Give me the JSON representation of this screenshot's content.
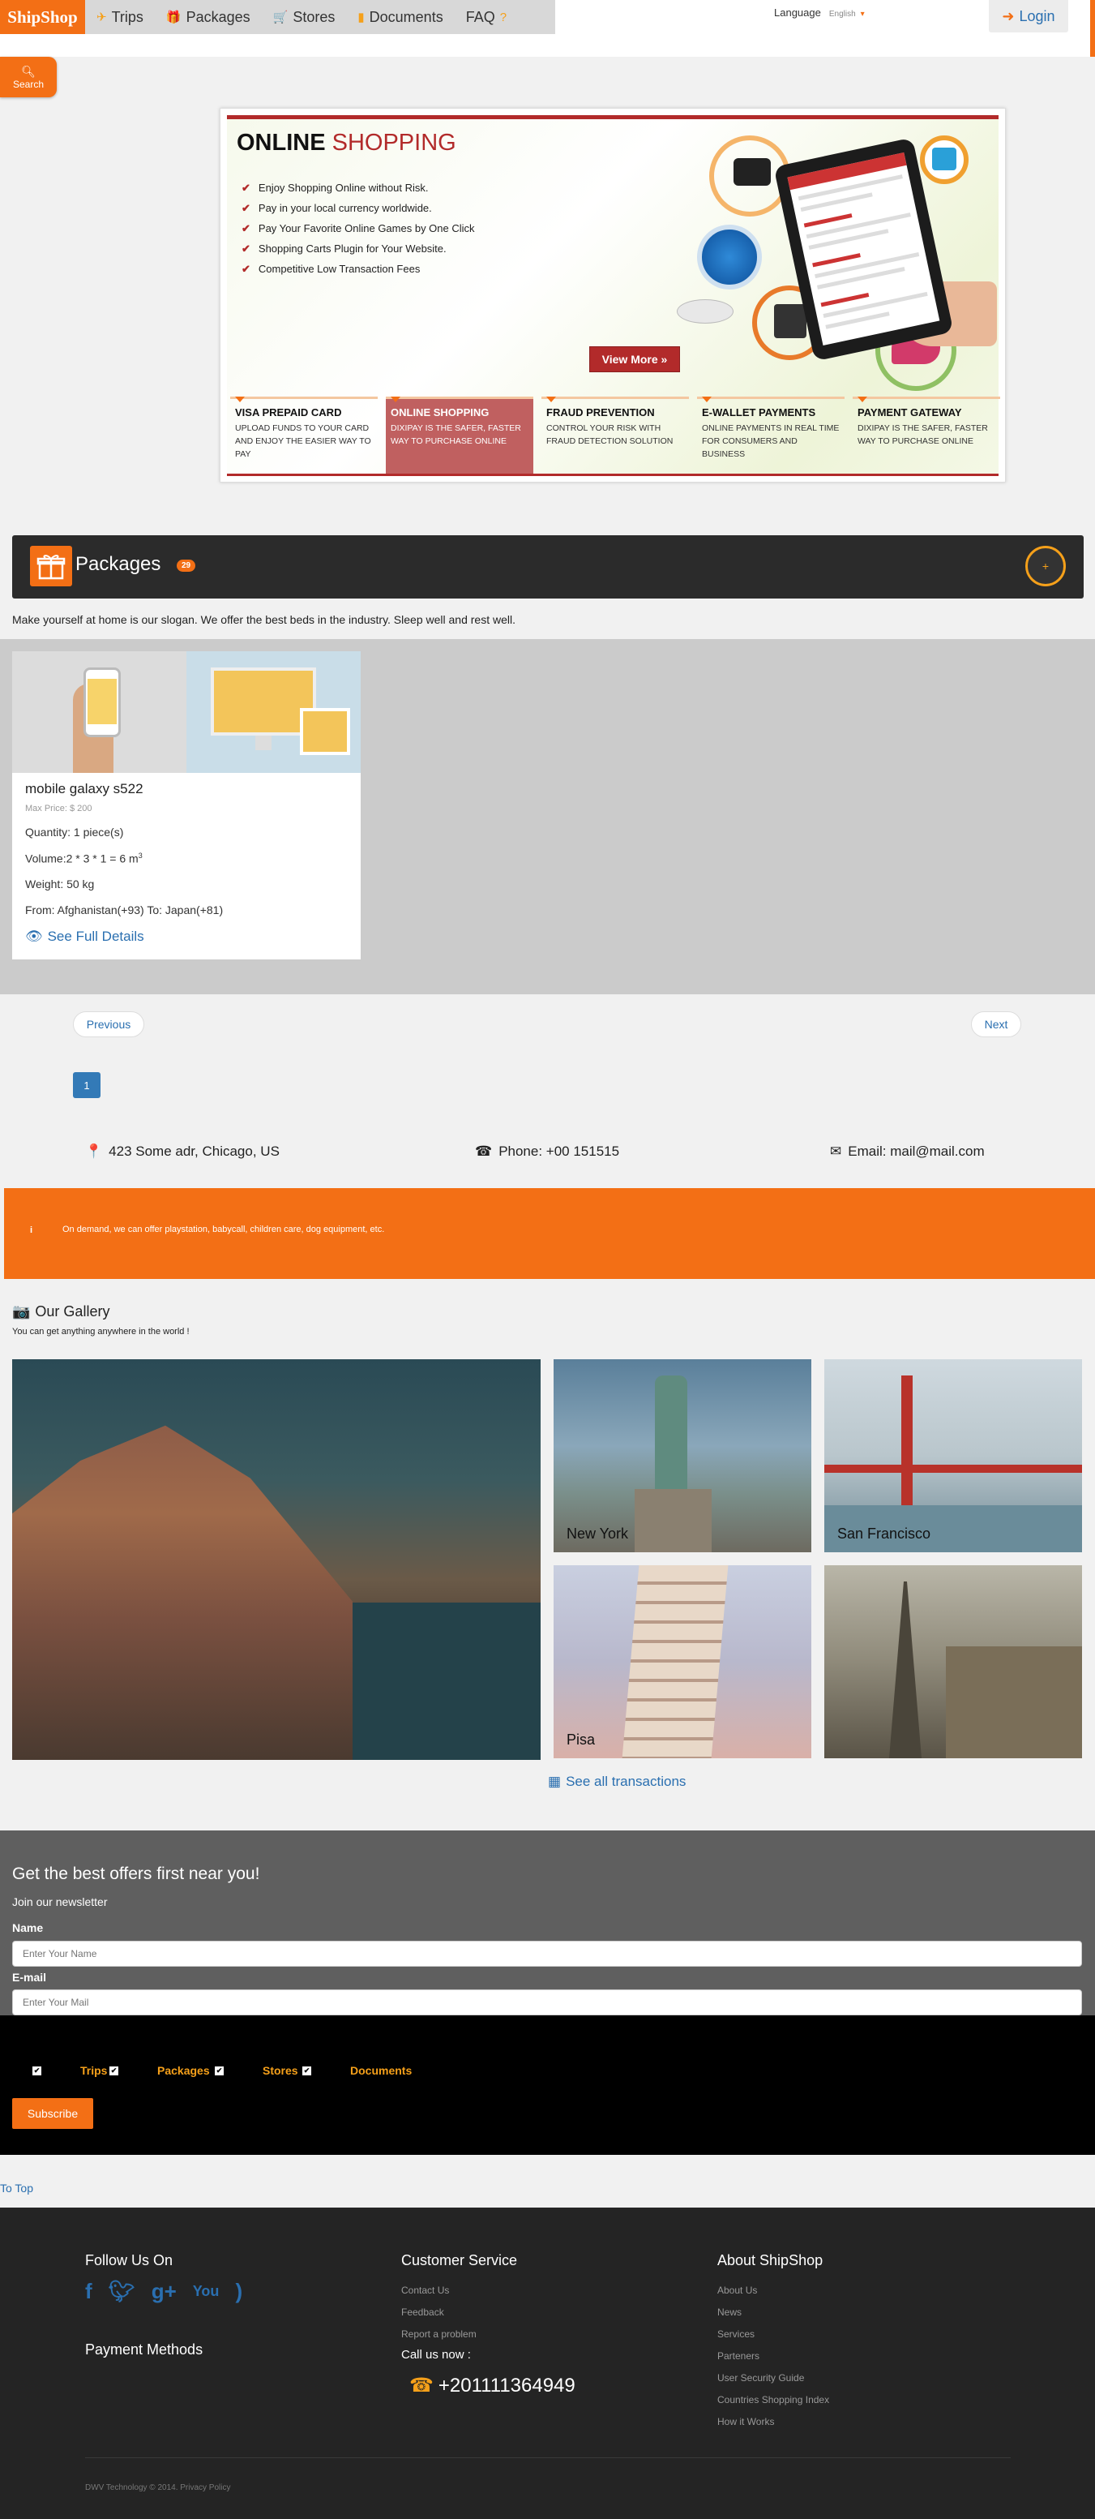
{
  "header": {
    "logo": "ShipShop",
    "nav": [
      {
        "label": "Trips",
        "icon": "plane-icon"
      },
      {
        "label": "Packages",
        "icon": "gift-icon"
      },
      {
        "label": "Stores",
        "icon": "cart-icon"
      },
      {
        "label": "Documents",
        "icon": "document-icon"
      },
      {
        "label": "FAQ",
        "icon": "question-icon"
      }
    ],
    "language_label": "Language",
    "language_value": "English",
    "login_label": "Login",
    "search_label": "Search"
  },
  "slider": {
    "title_bold": "ONLINE",
    "title_rest": "SHOPPING",
    "bullets": [
      "Enjoy Shopping Online without Risk.",
      "Pay in your local currency worldwide.",
      "Pay Your Favorite Online Games by One Click",
      "Shopping Carts Plugin for Your Website.",
      "Competitive Low Transaction Fees"
    ],
    "view_more": "View More",
    "tabs": [
      {
        "title": "VISA PREPAID CARD",
        "desc": "UPLOAD FUNDS TO YOUR CARD AND ENJOY THE EASIER WAY TO PAY"
      },
      {
        "title": "ONLINE SHOPPING",
        "desc": "DIXIPAY IS THE SAFER, FASTER WAY TO PURCHASE ONLINE"
      },
      {
        "title": "FRAUD PREVENTION",
        "desc": "CONTROL YOUR RISK WITH FRAUD DETECTION SOLUTION"
      },
      {
        "title": "E-WALLET PAYMENTS",
        "desc": "ONLINE PAYMENTS IN REAL TIME FOR CONSUMERS AND BUSINESS"
      },
      {
        "title": "PAYMENT GATEWAY",
        "desc": "DIXIPAY IS THE SAFER, FASTER WAY TO PURCHASE ONLINE"
      }
    ],
    "active_dot": 1
  },
  "packages": {
    "title": "Packages",
    "badge": "29",
    "add_label": "+",
    "description": "Make yourself at home is our slogan. We offer the best beds in the industry. Sleep well and rest well.",
    "card": {
      "name": "mobile galaxy s522",
      "max_price": "Max Price: $ 200",
      "quantity": "Quantity: 1 piece(s)",
      "volume": "Volume:2 * 3 * 1 = 6 m",
      "volume_sup": "3",
      "weight": "Weight: 50 kg",
      "route": "From: Afghanistan(+93) To: Japan(+81)",
      "details_link": "See Full Details"
    }
  },
  "pagination": {
    "previous": "Previous",
    "next": "Next",
    "current_page": "1"
  },
  "contact": {
    "address": "423 Some adr, Chicago, US",
    "phone": "Phone: +00 151515",
    "email": "Email: mail@mail.com"
  },
  "info_bar": {
    "icon_text": "i",
    "text": "On demand, we can offer playstation, babycall, children care, dog equipment, etc."
  },
  "gallery": {
    "title": "Our Gallery",
    "subtitle": "You can get anything anywhere in the world !",
    "captions": [
      "New York",
      "San Francisco",
      "Pisa"
    ],
    "see_all": "See all transactions"
  },
  "newsletter": {
    "heading": "Get the best offers first near you!",
    "subheading": "Join our newsletter",
    "name_label": "Name",
    "name_placeholder": "Enter Your Name",
    "email_label": "E-mail",
    "email_placeholder": "Enter Your Mail",
    "options": [
      "Trips",
      "Packages",
      "Stores",
      "Documents"
    ],
    "subscribe": "Subscribe"
  },
  "to_top": "To Top",
  "footer": {
    "follow_title": "Follow Us On",
    "social_icons": [
      "facebook-icon",
      "twitter-icon",
      "google-plus-icon",
      "youtube-icon",
      "rss-icon"
    ],
    "payment_title": "Payment Methods",
    "customer_title": "Customer Service",
    "customer_links": [
      "Contact Us",
      "Feedback",
      "Report a problem"
    ],
    "call_label": "Call us now :",
    "call_number": "+201111364949",
    "about_title": "About ShipShop",
    "about_links": [
      "About Us",
      "News",
      "Services",
      "Parteners",
      "User Security Guide",
      "Countries Shopping Index",
      "How it Works"
    ],
    "copyright": "DWV Technology © 2014. Privacy Policy"
  },
  "colors": {
    "brand_orange": "#f36f15",
    "accent_red": "#b22a2a",
    "link_blue": "#2a6fb0"
  }
}
